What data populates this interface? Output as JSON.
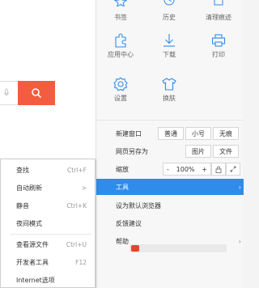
{
  "grid": {
    "row1": [
      {
        "label": "书签",
        "icon": "star-icon"
      },
      {
        "label": "历史",
        "icon": "clock-icon"
      },
      {
        "label": "清理痕迹",
        "icon": "trash-icon"
      }
    ],
    "row2": [
      {
        "label": "应用中心",
        "icon": "puzzle-icon"
      },
      {
        "label": "下载",
        "icon": "download-icon"
      },
      {
        "label": "打印",
        "icon": "printer-icon"
      }
    ],
    "row3": [
      {
        "label": "设置",
        "icon": "gear-icon"
      },
      {
        "label": "换肤",
        "icon": "shirt-icon"
      }
    ]
  },
  "menu": {
    "new_window": {
      "label": "新建窗口",
      "opts": [
        "普通",
        "小号",
        "无痕"
      ]
    },
    "save_as": {
      "label": "网页另存为",
      "opts": [
        "图片",
        "文件"
      ]
    },
    "zoom": {
      "label": "缩放",
      "minus": "-",
      "value": "100%",
      "plus": "+"
    },
    "tools": {
      "label": "工具"
    },
    "default_browser": {
      "label": "设为默认浏览器"
    },
    "feedback": {
      "label": "反馈建议"
    },
    "help": {
      "label": "帮助"
    }
  },
  "submenu": {
    "items": [
      {
        "label": "查找",
        "key": "Ctrl+F"
      },
      {
        "label": "自动刷新",
        "key": ">"
      },
      {
        "label": "静音",
        "key": "Ctrl+K"
      },
      {
        "label": "夜间模式",
        "key": ""
      },
      {
        "label": "查看源文件",
        "key": "Ctrl+U"
      },
      {
        "label": "开发者工具",
        "key": "F12"
      },
      {
        "label": "Internet选项",
        "key": ""
      }
    ]
  },
  "colors": {
    "accent": "#2f8ceb",
    "icon": "#2f8ceb",
    "search": "#f45c3f"
  }
}
